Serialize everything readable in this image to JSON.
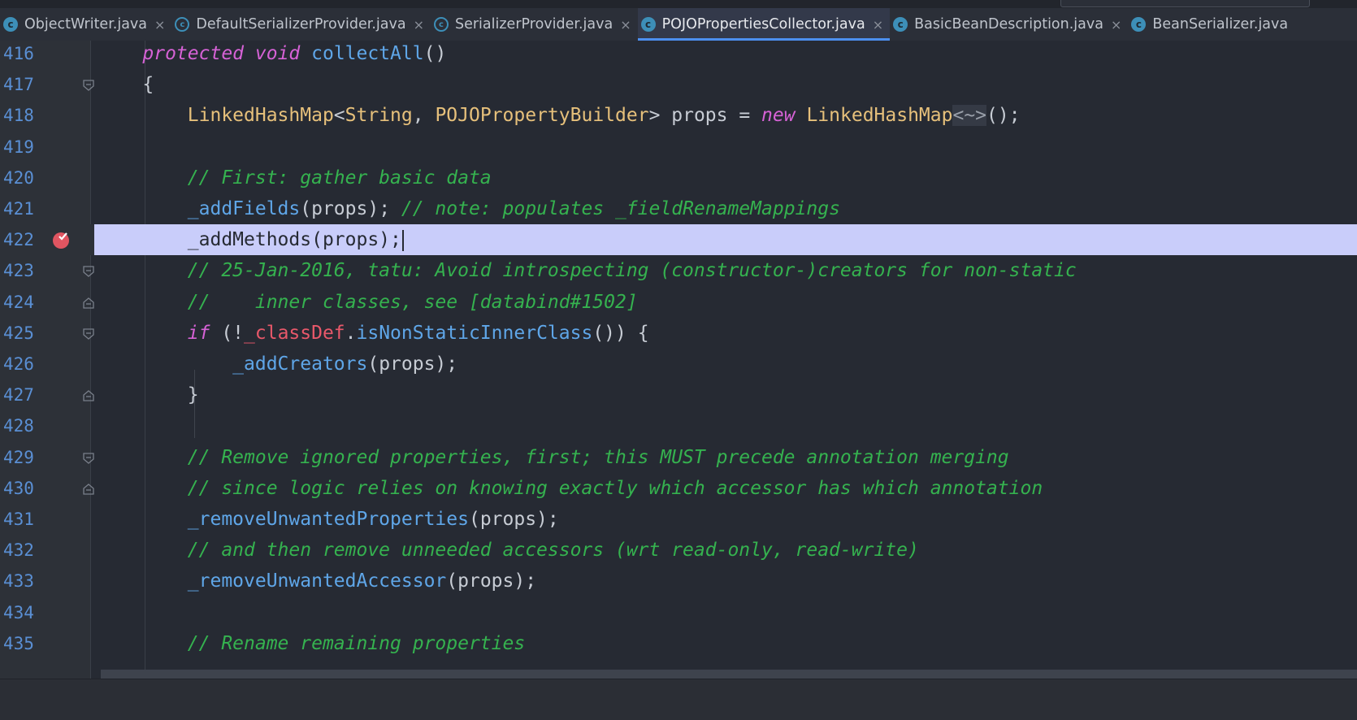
{
  "tabs": [
    {
      "label": "ObjectWriter.java",
      "icon": "class-icon",
      "active": false
    },
    {
      "label": "DefaultSerializerProvider.java",
      "icon": "abstract-class-icon",
      "active": false
    },
    {
      "label": "SerializerProvider.java",
      "icon": "abstract-class-icon",
      "active": false
    },
    {
      "label": "POJOPropertiesCollector.java",
      "icon": "class-icon",
      "active": true
    },
    {
      "label": "BasicBeanDescription.java",
      "icon": "class-icon",
      "active": false
    },
    {
      "label": "BeanSerializer.java",
      "icon": "class-icon",
      "active": false
    }
  ],
  "tab_close_glyph": "×",
  "class_icon_letter": "c",
  "editor": {
    "highlighted_line": 422,
    "breakpoint_line": 422,
    "colors": {
      "keyword": "#d662d6",
      "function": "#5fa6e8",
      "class": "#e6c07b",
      "comment": "#35b24f",
      "field": "#e8586a",
      "line_number": "#5a8fd4",
      "highlight": "#c9cdfa",
      "breakpoint": "#e05561"
    },
    "lines": [
      {
        "num": "416",
        "fold": "",
        "tokens": [
          [
            "t",
            "    "
          ],
          [
            "kw",
            "protected"
          ],
          [
            "t",
            " "
          ],
          [
            "kw",
            "void"
          ],
          [
            "t",
            " "
          ],
          [
            "fn",
            "collectAll"
          ],
          [
            "t",
            "()"
          ]
        ]
      },
      {
        "num": "417",
        "fold": "open",
        "tokens": [
          [
            "t",
            "    {"
          ]
        ]
      },
      {
        "num": "418",
        "fold": "",
        "tokens": [
          [
            "t",
            "        "
          ],
          [
            "cls",
            "LinkedHashMap"
          ],
          [
            "t",
            "<"
          ],
          [
            "cls",
            "String"
          ],
          [
            "t",
            ", "
          ],
          [
            "cls",
            "POJOPropertyBuilder"
          ],
          [
            "t",
            "> props = "
          ],
          [
            "kw",
            "new"
          ],
          [
            "t",
            " "
          ],
          [
            "cls",
            "LinkedHashMap"
          ],
          [
            "gen",
            "<~>"
          ],
          [
            "t",
            "();"
          ]
        ]
      },
      {
        "num": "419",
        "fold": "",
        "tokens": []
      },
      {
        "num": "420",
        "fold": "",
        "tokens": [
          [
            "t",
            "        "
          ],
          [
            "cm",
            "// First: gather basic data"
          ]
        ]
      },
      {
        "num": "421",
        "fold": "",
        "tokens": [
          [
            "t",
            "        "
          ],
          [
            "fn",
            "_addFields"
          ],
          [
            "t",
            "(props); "
          ],
          [
            "cm",
            "// note: populates _fieldRenameMappings"
          ]
        ]
      },
      {
        "num": "422",
        "fold": "",
        "tokens": [
          [
            "t",
            "        _addMethods(props);"
          ]
        ]
      },
      {
        "num": "423",
        "fold": "open",
        "tokens": [
          [
            "t",
            "        "
          ],
          [
            "cm",
            "// 25-Jan-2016, tatu: Avoid introspecting (constructor-)creators for non-static"
          ]
        ]
      },
      {
        "num": "424",
        "fold": "close",
        "tokens": [
          [
            "t",
            "        "
          ],
          [
            "cm",
            "//    inner classes, see [databind#1502]"
          ]
        ]
      },
      {
        "num": "425",
        "fold": "open",
        "tokens": [
          [
            "t",
            "        "
          ],
          [
            "kw",
            "if"
          ],
          [
            "t",
            " (!"
          ],
          [
            "fld",
            "_classDef"
          ],
          [
            "t",
            "."
          ],
          [
            "fn",
            "isNonStaticInnerClass"
          ],
          [
            "t",
            "()) {"
          ]
        ]
      },
      {
        "num": "426",
        "fold": "",
        "tokens": [
          [
            "t",
            "            "
          ],
          [
            "fn",
            "_addCreators"
          ],
          [
            "t",
            "(props);"
          ]
        ]
      },
      {
        "num": "427",
        "fold": "close",
        "tokens": [
          [
            "t",
            "        }"
          ]
        ]
      },
      {
        "num": "428",
        "fold": "",
        "tokens": []
      },
      {
        "num": "429",
        "fold": "open",
        "tokens": [
          [
            "t",
            "        "
          ],
          [
            "cm",
            "// Remove ignored properties, first; this MUST precede annotation merging"
          ]
        ]
      },
      {
        "num": "430",
        "fold": "close",
        "tokens": [
          [
            "t",
            "        "
          ],
          [
            "cm",
            "// since logic relies on knowing exactly which accessor has which annotation"
          ]
        ]
      },
      {
        "num": "431",
        "fold": "",
        "tokens": [
          [
            "t",
            "        "
          ],
          [
            "fn",
            "_removeUnwantedProperties"
          ],
          [
            "t",
            "(props);"
          ]
        ]
      },
      {
        "num": "432",
        "fold": "",
        "tokens": [
          [
            "t",
            "        "
          ],
          [
            "cm",
            "// and then remove unneeded accessors (wrt read-only, read-write)"
          ]
        ]
      },
      {
        "num": "433",
        "fold": "",
        "tokens": [
          [
            "t",
            "        "
          ],
          [
            "fn",
            "_removeUnwantedAccessor"
          ],
          [
            "t",
            "(props);"
          ]
        ]
      },
      {
        "num": "434",
        "fold": "",
        "tokens": []
      },
      {
        "num": "435",
        "fold": "",
        "tokens": [
          [
            "t",
            "        "
          ],
          [
            "cm",
            "// Rename remaining properties"
          ]
        ]
      }
    ]
  }
}
